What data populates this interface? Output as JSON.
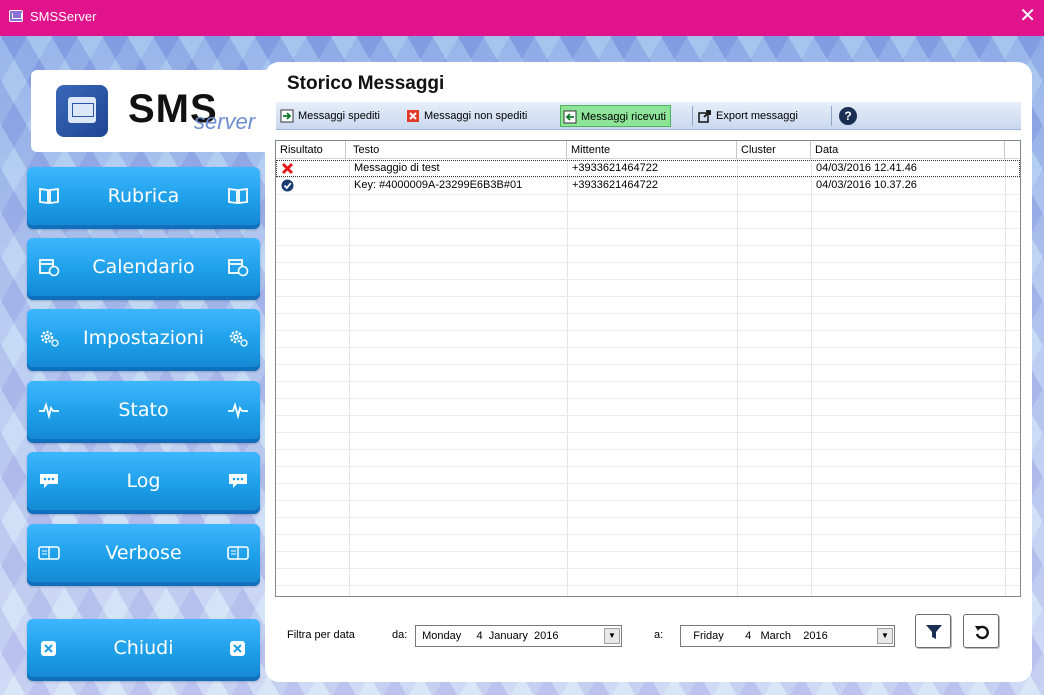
{
  "window": {
    "title": "SMSServer",
    "close_glyph": "✕"
  },
  "logo": {
    "main": "SMS",
    "sub": "server"
  },
  "sidebar": {
    "items": [
      {
        "label": "Rubrica",
        "icon": "book-icon"
      },
      {
        "label": "Calendario",
        "icon": "calendar-clock-icon"
      },
      {
        "label": "Impostazioni",
        "icon": "gear-icon"
      },
      {
        "label": "Stato",
        "icon": "heartbeat-icon"
      },
      {
        "label": "Log",
        "icon": "chat-bubble-icon"
      },
      {
        "label": "Verbose",
        "icon": "book-open-icon"
      },
      {
        "label": "Chiudi",
        "icon": "close-box-icon"
      }
    ]
  },
  "main": {
    "title": "Storico Messaggi",
    "toolbar": {
      "sent": "Messaggi spediti",
      "not_sent": "Messaggi non spediti",
      "received": "Messaggi ricevuti",
      "export": "Export messaggi",
      "help": "?"
    },
    "table": {
      "columns": [
        "Risultato",
        "Testo",
        "Mittente",
        "Cluster",
        "Data"
      ],
      "rows": [
        {
          "status": "error",
          "testo": "Messaggio di test",
          "mittente": "+3933621464722",
          "cluster": "",
          "data": "04/03/2016 12.41.46"
        },
        {
          "status": "ok",
          "testo": "Key: #4000009A-23299E6B3B#01",
          "mittente": "+3933621464722",
          "cluster": "",
          "data": "04/03/2016 10.37.26"
        }
      ]
    },
    "filter": {
      "label": "Filtra per data",
      "from_label": "da:",
      "to_label": "a:",
      "from_date": "  Monday     4  January  2016",
      "to_date": "    Friday       4   March    2016"
    }
  },
  "colors": {
    "titlebar": "#e0128c",
    "nav_button": "#1d9ee8",
    "active_toolbar": "#8ee59a"
  }
}
